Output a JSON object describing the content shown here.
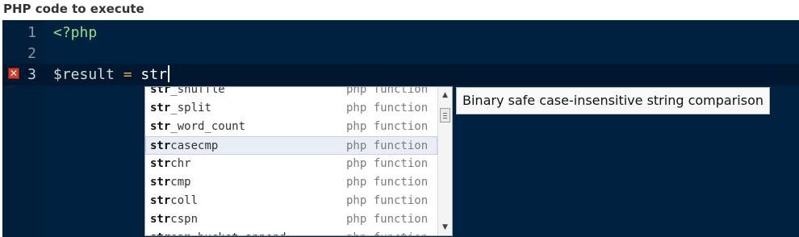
{
  "label": "PHP code to execute",
  "editor": {
    "lines": [
      {
        "number": "1",
        "tag": "<?php"
      },
      {
        "number": "2"
      },
      {
        "number": "3",
        "variable": "$result",
        "operator": "=",
        "text": "str",
        "error_marker": "✕"
      }
    ]
  },
  "autocomplete": {
    "items": [
      {
        "match": "str",
        "rest": "_shuffle",
        "meta": "php function"
      },
      {
        "match": "str",
        "rest": "_split",
        "meta": "php function"
      },
      {
        "match": "str",
        "rest": "_word_count",
        "meta": "php function"
      },
      {
        "match": "str",
        "rest": "casecmp",
        "meta": "php function",
        "selected": true
      },
      {
        "match": "str",
        "rest": "chr",
        "meta": "php function"
      },
      {
        "match": "str",
        "rest": "cmp",
        "meta": "php function"
      },
      {
        "match": "str",
        "rest": "coll",
        "meta": "php function"
      },
      {
        "match": "str",
        "rest": "cspn",
        "meta": "php function"
      },
      {
        "match": "str",
        "rest": "eam_bucket_append",
        "meta": "php function"
      }
    ],
    "scroll_up_glyph": "▲",
    "scroll_down_glyph": "▼"
  },
  "tooltip": "Binary safe case-insensitive string comparison",
  "colors": {
    "editor_bg": "#002240",
    "tag": "#8fe38b",
    "operator": "#f0a64b",
    "error": "#d33b2b",
    "selection": "#e8edf6"
  }
}
